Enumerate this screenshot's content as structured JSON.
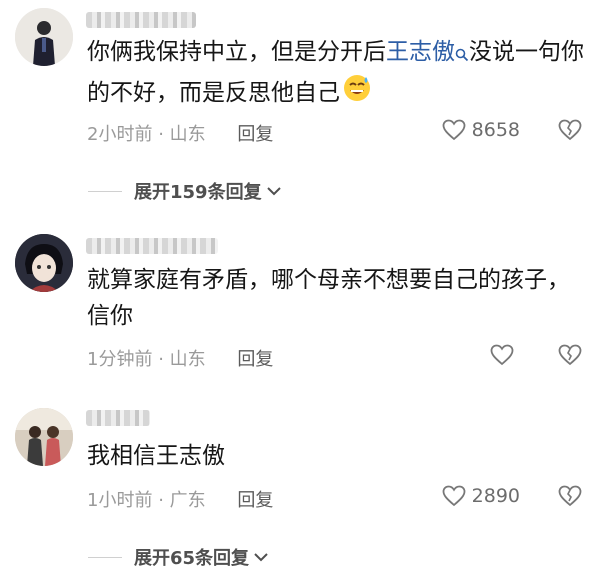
{
  "comments": [
    {
      "text_before": "你俩我保持中立，但是分开后",
      "highlight": "王志傲",
      "text_after": "没说一句你的不好，而是反思他自己",
      "time": "2小时前",
      "location": "山东",
      "reply_label": "回复",
      "likes": "8658",
      "emoji": "sweat-smile-emoji"
    },
    {
      "text": "就算家庭有矛盾，哪个母亲不想要自己的孩子，信你",
      "time": "1分钟前",
      "location": "山东",
      "reply_label": "回复",
      "likes": ""
    },
    {
      "text": "我相信王志傲",
      "time": "1小时前",
      "location": "广东",
      "reply_label": "回复",
      "likes": "2890"
    }
  ],
  "expand_1": "展开159条回复",
  "expand_2": "展开65条回复",
  "meta_separator": "·",
  "colors": {
    "highlight": "#2d5ea6",
    "meta": "#9a9a9a"
  }
}
